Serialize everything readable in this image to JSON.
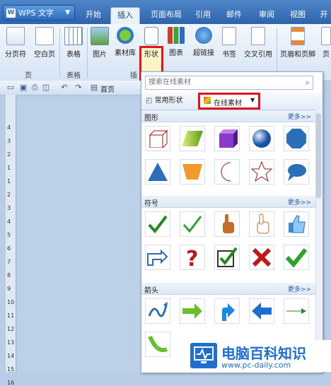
{
  "app": {
    "button_label": "WPS 文字",
    "logo_letter": "W"
  },
  "tabs": [
    "开始",
    "插入",
    "页面布局",
    "引用",
    "邮件",
    "审阅",
    "视图",
    "开"
  ],
  "ribbon": {
    "buttons": [
      "分页符",
      "空白页",
      "表格",
      "图片",
      "素材库",
      "形状",
      "图表",
      "超链接",
      "书签",
      "交叉引用",
      "页眉和页脚",
      "页"
    ],
    "groups": [
      "页",
      "表格",
      "插"
    ]
  },
  "toolbar": {
    "home_label": "首页"
  },
  "ruler": {
    "numbers": [
      "4",
      "3",
      "2",
      "1",
      "1",
      "2",
      "3",
      "4",
      "5",
      "6",
      "7",
      "8",
      "9",
      "10",
      "11",
      "12",
      "13",
      "14",
      "15",
      "16"
    ]
  },
  "panel": {
    "search_placeholder": "搜索在线素材",
    "tab_common": "常用形状",
    "tab_online": "在线素材",
    "more_label": "更多>>",
    "sections": [
      {
        "title": "图形",
        "items": [
          "cube-icon",
          "parallelogram-icon",
          "purple-box-icon",
          "blue-sphere-icon",
          "octagon-icon",
          "triangle-icon",
          "trapezoid-icon",
          "crescent-icon",
          "star-icon",
          "speech-bubble-icon"
        ]
      },
      {
        "title": "符号",
        "items": [
          "check-icon",
          "check-outline-icon",
          "hand-point-icon",
          "hand-up-icon",
          "thumbs-up-icon",
          "pointing-hand-icon",
          "question-icon",
          "checkbox-icon",
          "red-x-icon",
          "green-check-icon"
        ]
      },
      {
        "title": "箭头",
        "items": [
          "curly-arrow-icon",
          "green-arrow-icon",
          "up-arrow-icon",
          "blue-left-arrow-icon",
          "thin-arrow-icon",
          "curve-arrow-icon"
        ]
      }
    ]
  },
  "watermark": {
    "title": "电脑百科知识",
    "url": "www.pc-daily.com"
  },
  "colors": {
    "accent": "#2e64ab",
    "highlight": "#e0141b"
  }
}
